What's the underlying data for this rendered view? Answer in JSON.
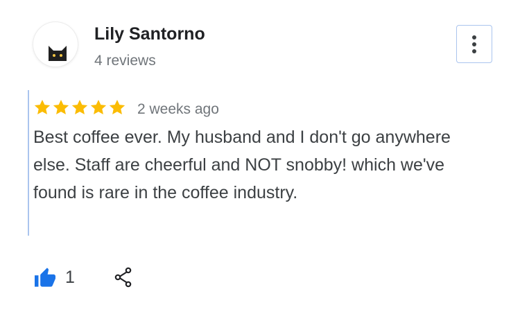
{
  "review": {
    "author": {
      "name": "Lily Santorno",
      "review_count": "4 reviews",
      "avatar_icon": "cat-icon"
    },
    "rating": 5,
    "max_rating": 5,
    "date": "2 weeks ago",
    "text": "Best coffee ever. My husband and I don't go anywhere else. Staff are cheerful and NOT snobby! which we've found is rare in the coffee industry.",
    "likes": "1"
  },
  "icons": {
    "menu": "more-vert-icon",
    "like": "thumbs-up-icon",
    "share": "share-icon",
    "star": "star-icon"
  },
  "colors": {
    "star": "#fbbc04",
    "like": "#1a73e8",
    "focus": "#aac4ee",
    "name": "#202124",
    "secondary": "#70757a",
    "body": "#3c4043"
  }
}
